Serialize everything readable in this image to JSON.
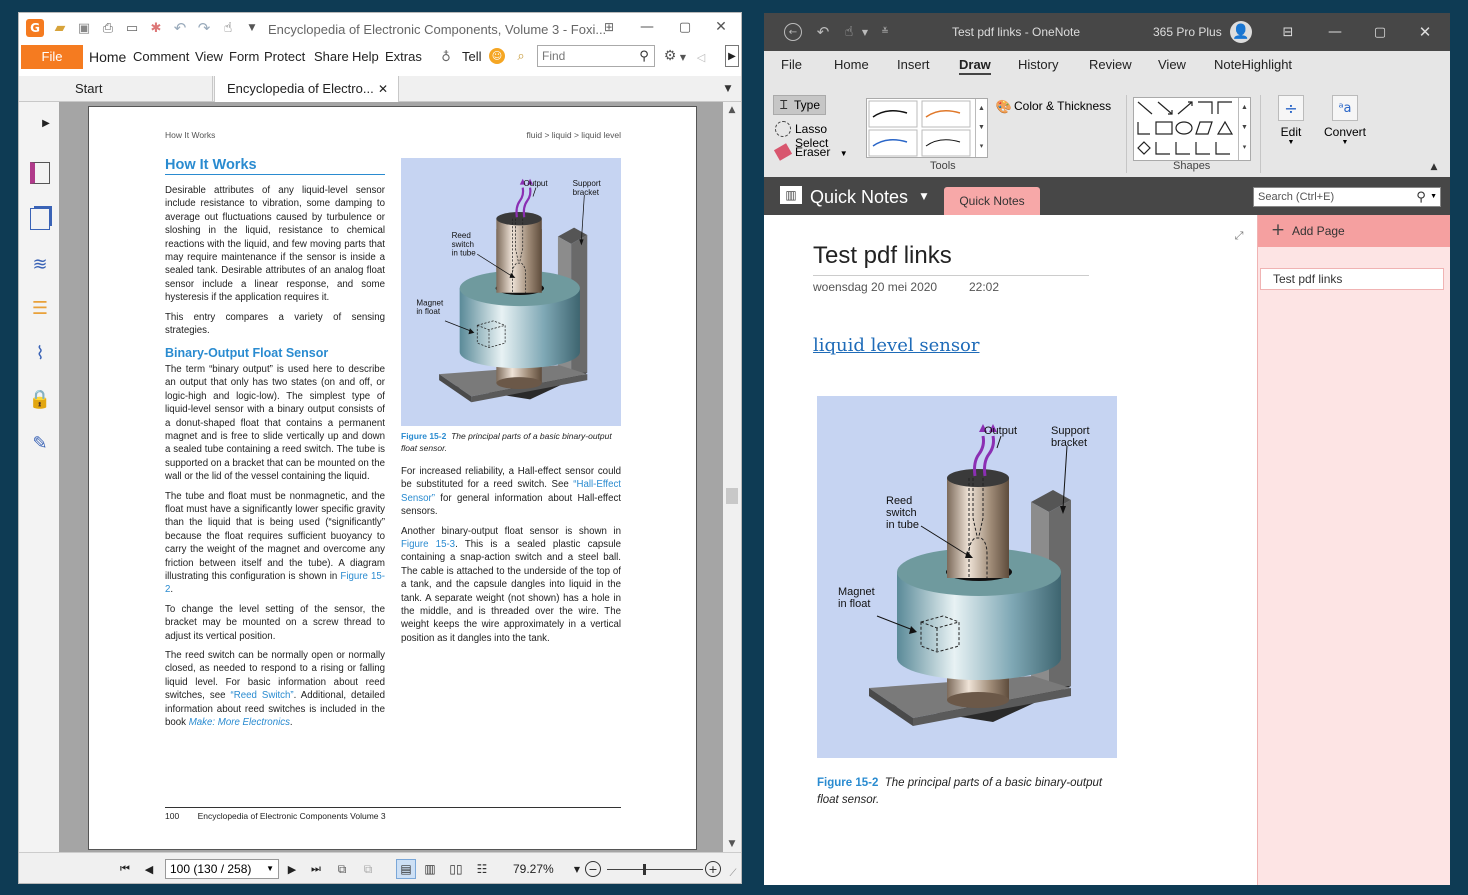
{
  "foxit": {
    "title": "Encyclopedia of Electronic Components, Volume 3 - Foxi...",
    "menu": [
      "File",
      "Home",
      "Comment",
      "View",
      "Form",
      "Protect",
      "Share",
      "Help",
      "Extras"
    ],
    "tell": "Tell",
    "find_placeholder": "Find",
    "tabs": [
      "Start",
      "Encyclopedia of Electro..."
    ],
    "page": {
      "running_left": "How It Works",
      "running_right": "fluid > liquid > liquid level",
      "heading1": "How It Works",
      "p1": "Desirable attributes of any liquid-level sensor include resistance to vibration, some damping to average out fluctuations caused by turbulence or sloshing in the liquid, resistance to chemical reactions with the liquid, and few moving parts that may require maintenance if the sensor is inside a sealed tank. Desirable attributes of an analog float sensor include a linear response, and some hysteresis if the application requires it.",
      "p2": "This entry compares a variety of sensing strategies.",
      "heading2": "Binary-Output Float Sensor",
      "p3": "The term “binary output” is used here to describe an output that only has two states (on and off, or logic-high and logic-low). The simplest type of liquid-level sensor with a binary output consists of a donut-shaped float that contains a permanent magnet and is free to slide vertically up and down a sealed tube containing a reed switch. The tube is supported on a bracket that can be mounted on the wall or the lid of the vessel containing the liquid.",
      "p4a": "The tube and float must be nonmagnetic, and the float must have a significantly lower specific gravity than the liquid that is being used (“significantly” because the float requires sufficient buoyancy to carry the weight of the magnet and overcome any friction between itself and the tube). A diagram illustrating this configuration is shown in ",
      "p4link": "Figure 15-2",
      "p4b": ".",
      "p5": "To change the level setting of the sensor, the bracket may be mounted on a screw thread to adjust its vertical position.",
      "p6a": "The reed switch can be normally open or normally closed, as needed to respond to a rising or falling liquid level. For basic information about reed switches, see ",
      "p6link": "“Reed Switch”",
      "p6b": ". Additional, detailed information about reed switches is included in the book ",
      "p6book": "Make: More Electronics",
      "p6c": ".",
      "fig_label": "Figure 15-2",
      "fig_caption": "The principal parts of a basic binary-output float sensor.",
      "r1a": "For increased reliability, a Hall-effect sensor could be substituted for a reed switch. See ",
      "r1link": "“Hall-Effect Sensor”",
      "r1b": " for general information about Hall-effect sensors.",
      "r2a": "Another binary-output float sensor is shown in ",
      "r2link": "Figure 15-3",
      "r2b": ". This is a sealed plastic capsule containing a snap-action switch and a steel ball. The cable is attached to the underside of the top of a tank, and the capsule dangles into liquid in the tank. A separate weight (not shown) has a hole in the middle, and is threaded over the wire. The weight keeps the wire approximately in a vertical position as it dangles into the tank.",
      "footer_num": "100",
      "footer_text": "Encyclopedia of Electronic Components Volume 3"
    },
    "diagram": {
      "output": "Output",
      "support1": "Support",
      "support2": "bracket",
      "reed1": "Reed",
      "reed2": "switch",
      "reed3": "in tube",
      "magnet1": "Magnet",
      "magnet2": "in float"
    },
    "status": {
      "page_value": "100 (130 / 258)",
      "zoom": "79.27%"
    }
  },
  "onenote": {
    "title": "Test pdf links  -  OneNote",
    "account": "365 Pro Plus",
    "tabs": [
      "File",
      "Home",
      "Insert",
      "Draw",
      "History",
      "Review",
      "View",
      "NoteHighlight"
    ],
    "tools": {
      "type": "Type",
      "lasso": "Lasso Select",
      "eraser": "Eraser",
      "color": "Color & Thickness",
      "group_tools": "Tools",
      "group_shapes": "Shapes",
      "edit": "Edit",
      "convert": "Convert"
    },
    "notebook": "Quick Notes",
    "section_tab": "Quick Notes",
    "search_placeholder": "Search (Ctrl+E)",
    "page_title": "Test pdf links",
    "date": "woensdag 20 mei 2020",
    "time": "22:02",
    "link": "liquid level sensor",
    "fig_label": "Figure 15-2",
    "fig_caption_1": "The principal parts of a basic binary-output",
    "fig_caption_2": "float sensor.",
    "add_page": "Add Page",
    "page_item": "Test pdf links"
  },
  "colors": {
    "foxit_orange": "#f57b20",
    "link_blue": "#2a8bd0",
    "onenote_purple": "#7719aa",
    "onenote_title": "#474747",
    "pane_pink": "#fde4e4"
  }
}
